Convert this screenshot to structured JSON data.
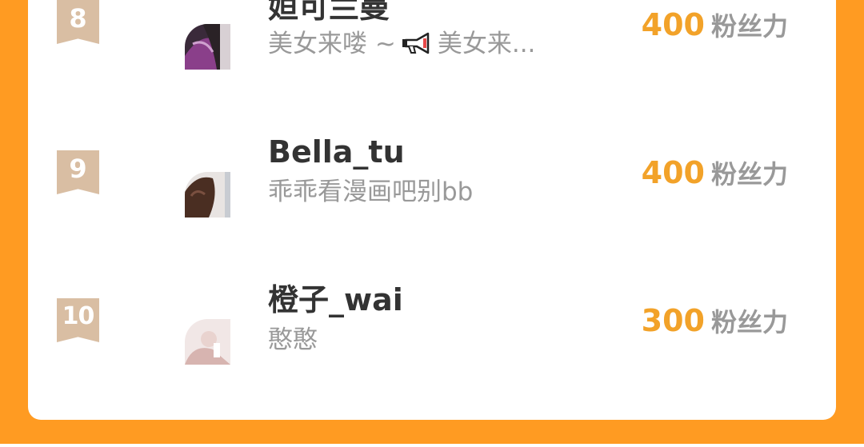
{
  "colors": {
    "frame": "#FF9B22",
    "card": "#FFFFFF",
    "score": "#F2A229",
    "badge": "#D9BEA3",
    "name": "#333333",
    "desc": "#999999"
  },
  "score_unit": "粉丝力",
  "leaderboard": [
    {
      "rank": "8",
      "name": "姮可兰曼",
      "desc_before": "美女来喽 ~",
      "icon": "megaphone-icon",
      "desc_after": "美女来...",
      "score": "400"
    },
    {
      "rank": "9",
      "name": "Bella_tu",
      "desc": "乖乖看漫画吧别bb",
      "score": "400"
    },
    {
      "rank": "10",
      "name": "橙子_wai",
      "desc": "憨憨",
      "score": "300"
    }
  ]
}
